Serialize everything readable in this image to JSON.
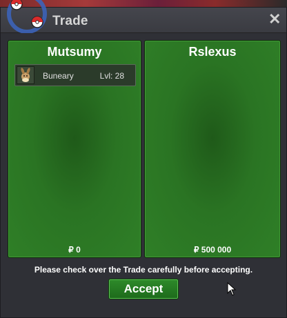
{
  "window": {
    "title": "Trade",
    "close_label": "✕"
  },
  "left_panel": {
    "name": "Mutsumy",
    "items": [
      {
        "name": "Buneary",
        "level": "Lvl: 28"
      }
    ],
    "money": "₽ 0"
  },
  "right_panel": {
    "name": "Rslexus",
    "money": "₽ 500 000"
  },
  "notice": "Please check over the Trade carefully before accepting.",
  "accept_label": "Accept",
  "colors": {
    "panel_green": "#2f7f27",
    "button_green": "#2e8a2a",
    "window_bg": "#2f3036"
  },
  "icons": {
    "logo": "pokeball-arrows-logo-icon",
    "close": "close-icon",
    "item": "buneary-sprite-icon",
    "cursor": "mouse-cursor-icon"
  }
}
